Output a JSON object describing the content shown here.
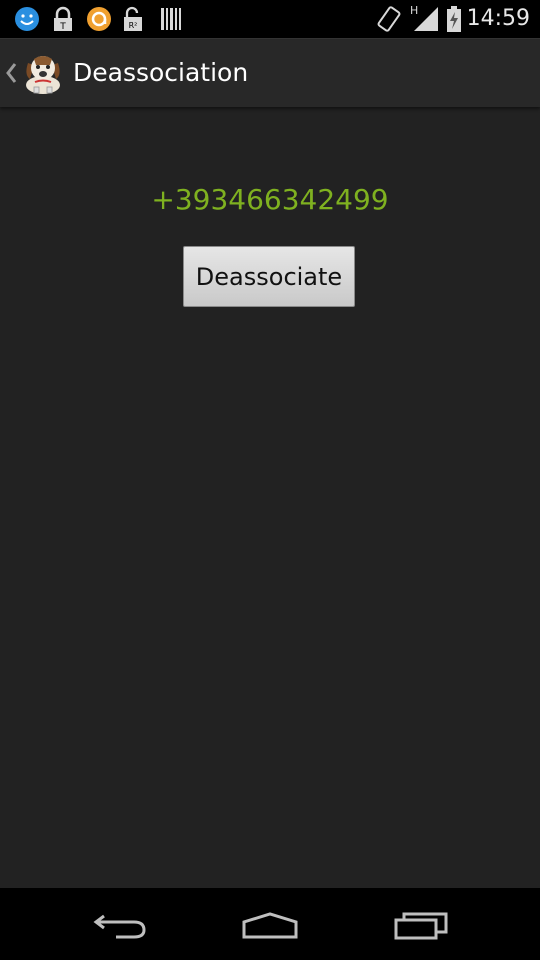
{
  "status_bar": {
    "time": "14:59",
    "network_type": "H",
    "icons": [
      "smiley-icon",
      "lock-icon",
      "orange-circle-icon",
      "unlock-r2-icon",
      "barcode-icon",
      "rotation-icon",
      "signal-icon",
      "battery-charging-icon"
    ]
  },
  "action_bar": {
    "title": "Deassociation",
    "app_icon": "dog-app-icon"
  },
  "main": {
    "phone_number": "+393466342499",
    "deassociate_label": "Deassociate"
  },
  "nav_bar": {
    "buttons": [
      "back-icon",
      "home-icon",
      "recent-apps-icon"
    ]
  },
  "colors": {
    "background": "#222222",
    "phone_number": "#7fb120",
    "action_bar": "#282828"
  }
}
